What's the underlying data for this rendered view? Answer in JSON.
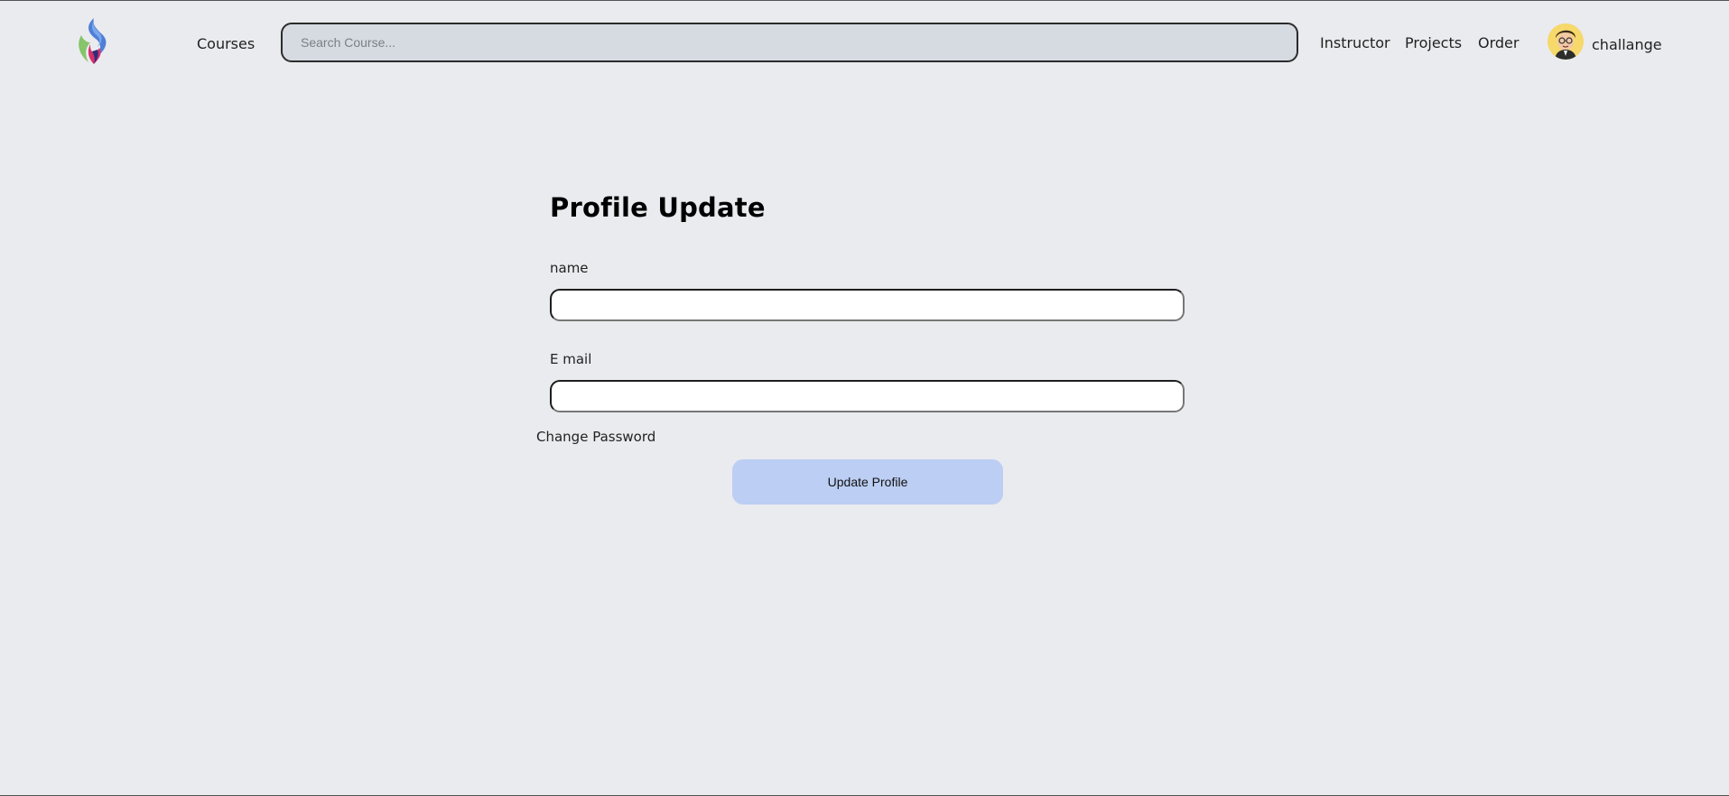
{
  "nav": {
    "courses_label": "Courses",
    "search": {
      "placeholder": "Search Course...",
      "value": ""
    },
    "links": {
      "instructor": "Instructor",
      "projects": "Projects",
      "order": "Order"
    },
    "user": {
      "name": "challange",
      "avatar_icon": "avatar-icon"
    },
    "logo_icon": "flame-logo-icon"
  },
  "form": {
    "title": "Profile Update",
    "name_label": "name",
    "name_value": "",
    "email_label": "E mail",
    "email_value": "",
    "change_password_label": "Change Password",
    "submit_label": "Update Profile"
  },
  "colors": {
    "background": "#eaebef",
    "search_background": "#d6dae1",
    "button_background": "#bccef3",
    "avatar_background": "#f6d86b"
  }
}
